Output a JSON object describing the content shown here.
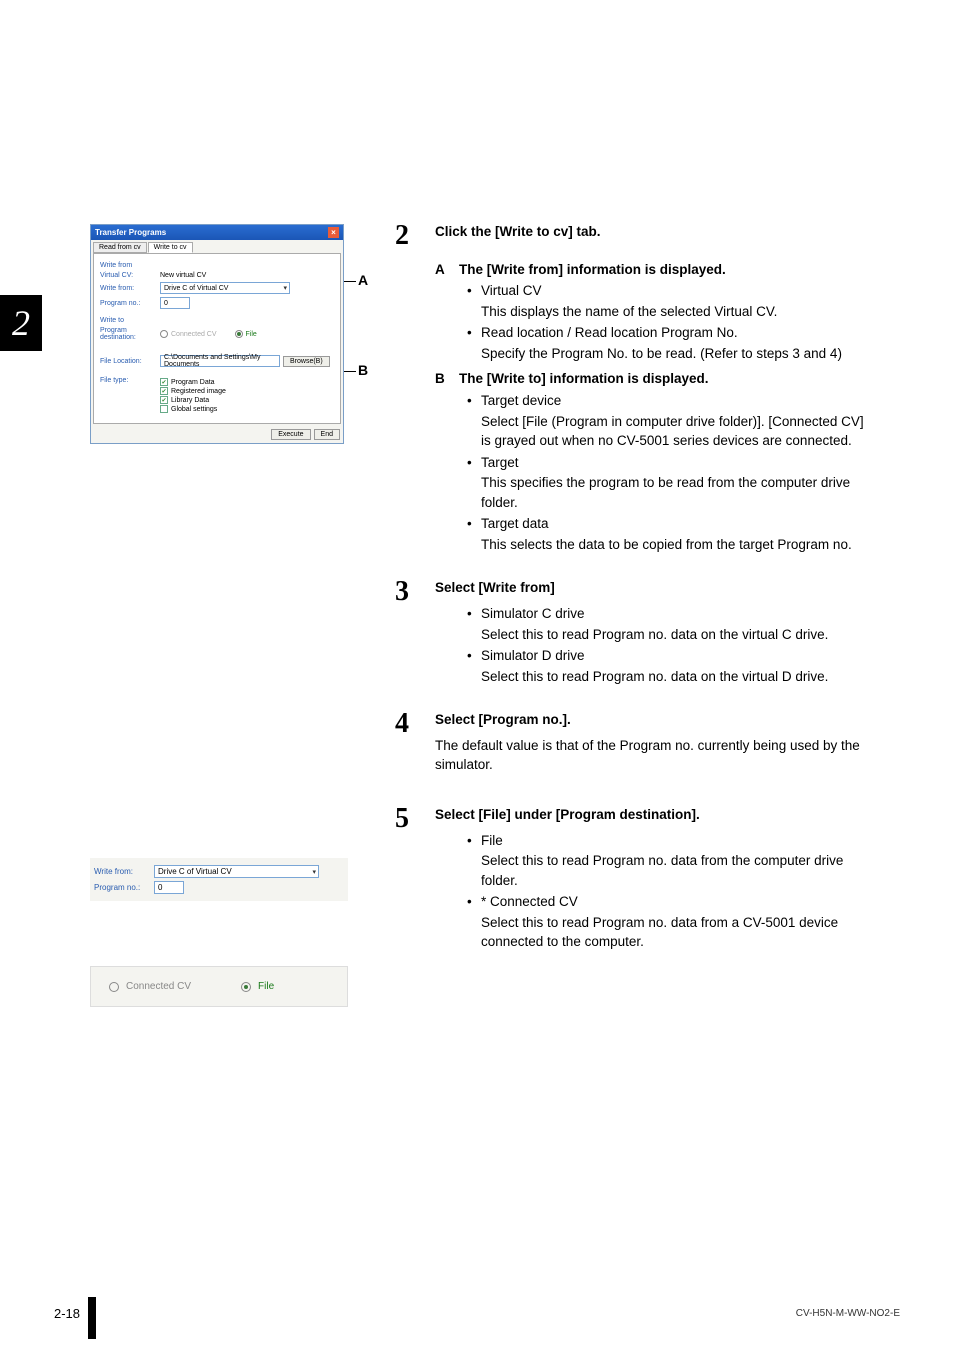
{
  "chapter_tab": "2",
  "dialog": {
    "title": "Transfer Programs",
    "tabs": {
      "read": "Read from cv",
      "write": "Write to cv"
    },
    "write_from_section": "Write from",
    "virtual_cv_label": "Virtual CV:",
    "virtual_cv_value": "New virtual CV",
    "write_from_label": "Write from:",
    "write_from_value": "Drive C of Virtual CV",
    "program_no_label": "Program no.:",
    "program_no_value": "0",
    "write_to_section": "Write to",
    "program_dest_label": "Program destination:",
    "radio_connected": "Connected CV",
    "radio_file": "File",
    "file_location_label": "File Location:",
    "file_location_value": "C:\\Documents and Settings\\My Documents",
    "browse_btn": "Browse(B)",
    "file_type_label": "File type:",
    "checkboxes": {
      "program_data": "Program Data",
      "registered_image": "Registered image",
      "library_data": "Library Data",
      "global_settings": "Global settings"
    },
    "execute_btn": "Execute",
    "end_btn": "End"
  },
  "mini": {
    "write_from_label": "Write from:",
    "write_from_value": "Drive C of Virtual CV",
    "program_no_label": "Program no.:",
    "program_no_value": "0"
  },
  "radio_strip": {
    "connected_cv": "Connected CV",
    "file": "File"
  },
  "callouts": {
    "a": "A",
    "b": "B"
  },
  "steps": {
    "s2": {
      "num": "2",
      "title": "Click the [Write to cv] tab.",
      "A": {
        "letter": "A",
        "title": "The [Write from] information is displayed.",
        "b1_head": "Virtual CV",
        "b1_body": "This displays the name of the selected Virtual CV.",
        "b2_head": "Read location / Read location Program No.",
        "b2_body": "Specify the Program No. to be read. (Refer to steps 3 and 4)"
      },
      "B": {
        "letter": "B",
        "title": "The [Write to] information is displayed.",
        "b1_head": "Target device",
        "b1_body": "Select [File (Program in computer drive folder)]. [Connected CV] is grayed out when no CV-5001 series devices are connected.",
        "b2_head": "Target",
        "b2_body": "This specifies the program to be read from the computer drive folder.",
        "b3_head": "Target data",
        "b3_body": "This selects the data to be copied from the target Program no."
      }
    },
    "s3": {
      "num": "3",
      "title": "Select [Write from]",
      "b1_head": "Simulator C drive",
      "b1_body": "Select this to read Program no. data on the virtual C drive.",
      "b2_head": "Simulator D drive",
      "b2_body": "Select this to read Program no. data on the virtual D drive."
    },
    "s4": {
      "num": "4",
      "title": "Select [Program no.].",
      "body": "The default value is that of the Program no. currently being used by the simulator."
    },
    "s5": {
      "num": "5",
      "title": "Select [File] under [Program destination].",
      "b1_head": "File",
      "b1_body": "Select this to read Program no. data from the computer drive folder.",
      "b2_head": "* Connected CV",
      "b2_body": "Select this to read Program no. data from a CV-5001 device connected to the computer."
    }
  },
  "footer": {
    "page": "2-18",
    "docid": "CV-H5N-M-WW-NO2-E"
  }
}
